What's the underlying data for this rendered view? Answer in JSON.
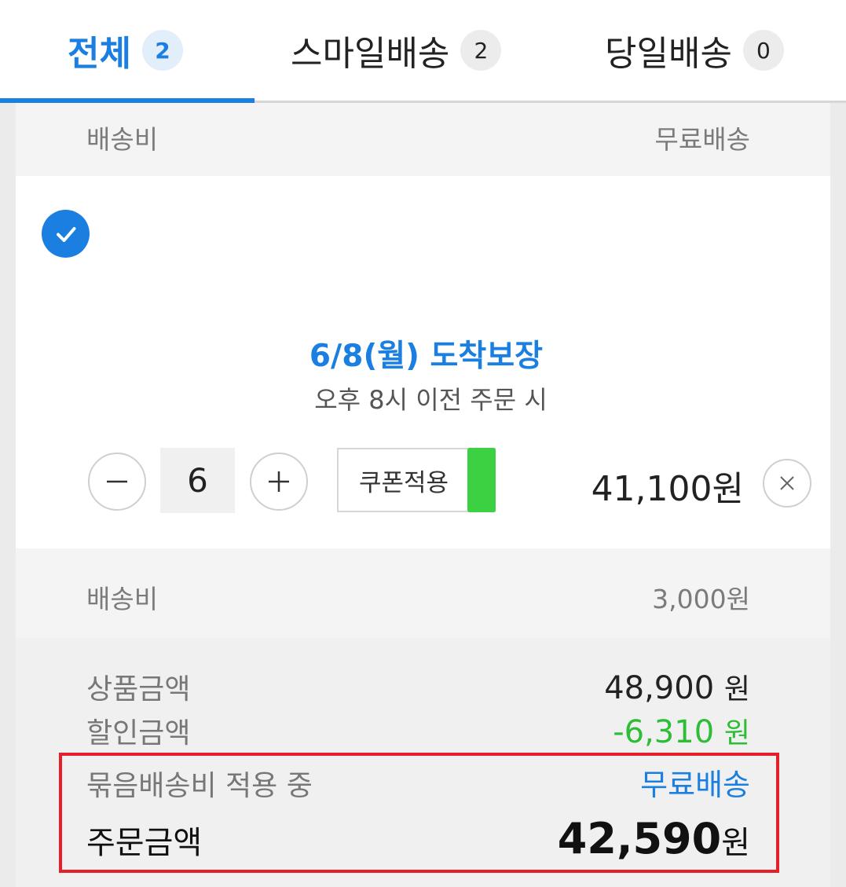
{
  "tabs": [
    {
      "label": "전체",
      "count": "2"
    },
    {
      "label": "스마일배송",
      "count": "2"
    },
    {
      "label": "당일배송",
      "count": "0"
    }
  ],
  "prev_shipping": {
    "label": "배송비",
    "value": "무료배송"
  },
  "item": {
    "arrival_title": "6/8(월) 도착보장",
    "arrival_sub": "오후 8시 이전 주문 시",
    "quantity": "6",
    "coupon_label": "쿠폰적용",
    "price": "41,100원"
  },
  "shipping": {
    "label": "배송비",
    "value": "3,000원"
  },
  "summary": {
    "product_label": "상품금액",
    "product_value": "48,900",
    "product_unit": "원",
    "discount_label": "할인금액",
    "discount_value": "-6,310",
    "discount_unit": "원",
    "bundle_label": "묶음배송비 적용 중",
    "bundle_value": "무료배송",
    "total_label": "주문금액",
    "total_value": "42,590",
    "total_unit": "원"
  },
  "colors": {
    "accent": "#1a7fe0",
    "discount": "#2dbd36",
    "highlight": "#e32028",
    "coupon_tag": "#3cd142"
  }
}
